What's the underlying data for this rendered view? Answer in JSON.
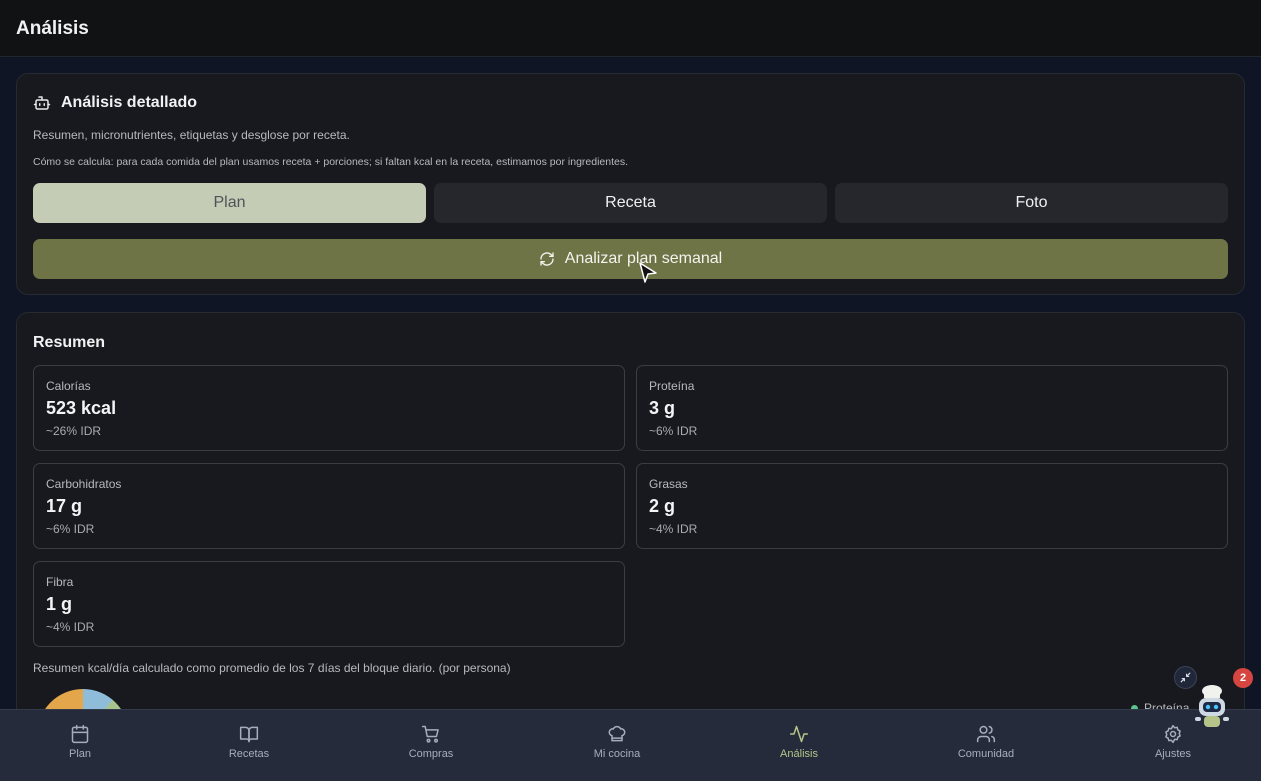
{
  "header": {
    "title": "Análisis"
  },
  "analysis": {
    "title": "Análisis detallado",
    "description": "Resumen, micronutrientes, etiquetas y desglose por receta.",
    "calc_note": "Cómo se calcula: para cada comida del plan usamos receta + porciones; si faltan kcal en la receta, estimamos por ingredientes.",
    "tabs": [
      {
        "label": "Plan",
        "active": true
      },
      {
        "label": "Receta",
        "active": false
      },
      {
        "label": "Foto",
        "active": false
      }
    ],
    "analyze_button": "Analizar plan semanal"
  },
  "summary": {
    "title": "Resumen",
    "stats": [
      {
        "label": "Calorías",
        "value": "523 kcal",
        "pct": "~26% IDR"
      },
      {
        "label": "Proteína",
        "value": "3 g",
        "pct": "~6% IDR"
      },
      {
        "label": "Carbohidratos",
        "value": "17 g",
        "pct": "~6% IDR"
      },
      {
        "label": "Grasas",
        "value": "2 g",
        "pct": "~4% IDR"
      },
      {
        "label": "Fibra",
        "value": "1 g",
        "pct": "~4% IDR"
      }
    ],
    "note": "Resumen kcal/día calculado como promedio de los 7 días del bloque diario. (por persona)",
    "legend_first": "Proteína"
  },
  "nav": {
    "items": [
      {
        "label": "Plan",
        "icon": "calendar-icon"
      },
      {
        "label": "Recetas",
        "icon": "book-icon"
      },
      {
        "label": "Compras",
        "icon": "cart-icon"
      },
      {
        "label": "Mi cocina",
        "icon": "chef-hat-icon"
      },
      {
        "label": "Análisis",
        "icon": "activity-icon",
        "active": true
      },
      {
        "label": "Comunidad",
        "icon": "users-icon"
      },
      {
        "label": "Ajustes",
        "icon": "gear-icon"
      }
    ]
  },
  "assistant": {
    "badge": "2"
  },
  "colors": {
    "accent": "#6e7446",
    "active_tab": "#c5ccb5",
    "nav_active": "#b6c48a",
    "badge": "#d6453f"
  }
}
